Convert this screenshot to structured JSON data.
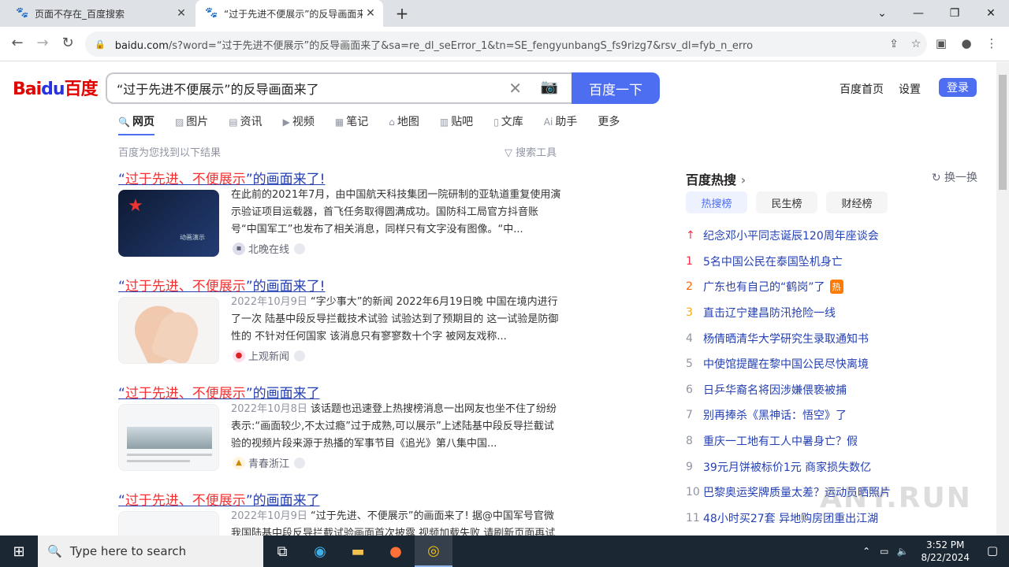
{
  "browser": {
    "tabs": [
      {
        "title": "页面不存在_百度搜索",
        "active": false
      },
      {
        "title": "“过于先进不便展示”的反导画面来了",
        "active": true
      }
    ],
    "url_domain": "baidu.com",
    "url_path": "/s?word=“过于先进不便展示”的反导画面来了&sa=re_dl_seError_1&tn=SE_fengyunbangS_fs9rizg7&rsv_dl=fyb_n_erro"
  },
  "page": {
    "logo": {
      "bai": "Bai",
      "du": "du",
      "cn": "百度"
    },
    "search": {
      "query": "“过于先进不便展示”的反导画面来了",
      "button": "百度一下"
    },
    "toplinks": {
      "home": "百度首页",
      "settings": "设置",
      "login": "登录"
    },
    "tabs": [
      "网页",
      "图片",
      "资讯",
      "视频",
      "笔记",
      "地图",
      "贴吧",
      "文库",
      "助手",
      "更多"
    ],
    "found_text": "百度为您找到以下结果",
    "tools_text": "搜索工具",
    "results": [
      {
        "title_pre": "“",
        "title_em": "过于先进、不便展示",
        "title_post": "”的画面来了!",
        "date": "",
        "abstract": "在此前的2021年7月，由中国航天科技集团一院研制的亚轨道重复使用演示验证项目运载器，首飞任务取得圆满成功。国防科工局官方抖音账号“中国军工”也发布了相关消息，同样只有文字没有图像。“中...",
        "source": "北晚在线"
      },
      {
        "title_pre": "“",
        "title_em": "过于先进、不便展示",
        "title_post": "”的画面来了!",
        "date": "2022年10月9日",
        "abstract": "“字少事大”的新闻 2022年6月19日晚 中国在境内进行了一次 陆基中段反导拦截技术试验 试验达到了预期目的 这一试验是防御性的 不针对任何国家 该消息只有寥寥数十个字 被网友戏称...",
        "source": "上观新闻"
      },
      {
        "title_pre": "“",
        "title_em": "过于先进、不便展示",
        "title_post": "”的画面来了",
        "date": "2022年10月8日",
        "abstract": "该话题也迅速登上热搜榜消息一出网友也坐不住了纷纷表示:“画面较少,不太过瘾”过于成熟,可以展示”上述陆基中段反导拦截试验的视频片段来源于热播的军事节目《追光》第八集中国...",
        "source": "青春浙江"
      },
      {
        "title_pre": "“",
        "title_em": "过于先进、不便展示",
        "title_post": "”的画面来了",
        "date": "2022年10月9日",
        "abstract": "“过于先进、不便展示”的画面来了! 据@中国军号官微 我国陆基中段反导拦截试验画面首次披露 视频加载失败 请刷新页面再试 刷...",
        "source": ""
      }
    ],
    "hot": {
      "title": "百度热搜",
      "swap": "换一换",
      "boards": [
        "热搜榜",
        "民生榜",
        "财经榜"
      ],
      "items": [
        {
          "num": "↑",
          "text": "纪念邓小平同志诞辰120周年座谈会",
          "tag": ""
        },
        {
          "num": "1",
          "text": "5名中国公民在泰国坠机身亡",
          "tag": ""
        },
        {
          "num": "2",
          "text": "广东也有自己的“鹤岗”了",
          "tag": "热"
        },
        {
          "num": "3",
          "text": "直击辽宁建昌防汛抢险一线",
          "tag": ""
        },
        {
          "num": "4",
          "text": "杨倩晒清华大学研究生录取通知书",
          "tag": ""
        },
        {
          "num": "5",
          "text": "中使馆提醒在黎中国公民尽快离境",
          "tag": ""
        },
        {
          "num": "6",
          "text": "日乒华裔名将因涉嫌偎亵被捕",
          "tag": ""
        },
        {
          "num": "7",
          "text": "别再捧杀《黑神话：悟空》了",
          "tag": ""
        },
        {
          "num": "8",
          "text": "重庆一工地有工人中暑身亡？假",
          "tag": ""
        },
        {
          "num": "9",
          "text": "39元月饼被标价1元 商家损失数亿",
          "tag": ""
        },
        {
          "num": "10",
          "text": "巴黎奥运奖牌质量太差？运动员晒照片",
          "tag": ""
        },
        {
          "num": "11",
          "text": "48小时买27套 异地购房团重出江湖",
          "tag": ""
        }
      ]
    }
  },
  "taskbar": {
    "search_placeholder": "Type here to search",
    "time": "3:52 PM",
    "date": "8/22/2024"
  }
}
